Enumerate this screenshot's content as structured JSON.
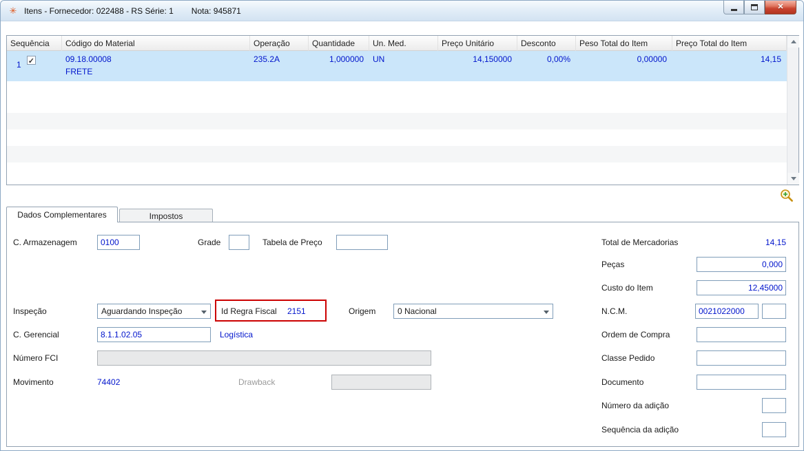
{
  "window": {
    "title_left": "Itens - Fornecedor: 022488 - RS Série: 1",
    "title_right": "Nota: 945871"
  },
  "grid": {
    "columns": [
      "Sequência",
      "Código do Material",
      "Operação",
      "Quantidade",
      "Un. Med.",
      "Preço Unitário",
      "Desconto",
      "Peso Total do Item",
      "Preço Total do Item"
    ],
    "rows": [
      {
        "sequencia": "1",
        "checked": true,
        "codigo": "09.18.00008",
        "descricao": "FRETE",
        "operacao": "235.2A",
        "quantidade": "1,000000",
        "un_med": "UN",
        "preco_unitario": "14,150000",
        "desconto": "0,00%",
        "peso_total_item": "0,00000",
        "preco_total_item": "14,15"
      }
    ]
  },
  "tabs": {
    "dados_complementares": "Dados Complementares",
    "impostos": "Impostos"
  },
  "form": {
    "c_armazenagem": {
      "label": "C. Armazenagem",
      "value": "0100"
    },
    "grade": {
      "label": "Grade",
      "value": ""
    },
    "tabela_preco": {
      "label": "Tabela de Preço",
      "value": ""
    },
    "total_mercadorias": {
      "label": "Total de Mercadorias",
      "value": "14,15"
    },
    "pecas": {
      "label": "Peças",
      "value": "0,000"
    },
    "custo_item": {
      "label": "Custo do Item",
      "value": "12,45000"
    },
    "inspecao": {
      "label": "Inspeção",
      "value": "Aguardando Inspeção"
    },
    "id_regra_fiscal": {
      "label": "Id Regra Fiscal",
      "value": "2151"
    },
    "origem": {
      "label": "Origem",
      "value": "0 Nacional"
    },
    "ncm": {
      "label": "N.C.M.",
      "value": "0021022000",
      "value2": ""
    },
    "c_gerencial": {
      "label": "C. Gerencial",
      "value": "8.1.1.02.05",
      "description": "Logística"
    },
    "ordem_compra": {
      "label": "Ordem de Compra",
      "value": ""
    },
    "numero_fci": {
      "label": "Número FCI",
      "value": ""
    },
    "classe_pedido": {
      "label": "Classe Pedido",
      "value": ""
    },
    "movimento": {
      "label": "Movimento",
      "value": "74402"
    },
    "drawback": {
      "label": "Drawback",
      "value": ""
    },
    "documento": {
      "label": "Documento",
      "value": ""
    },
    "numero_adicao": {
      "label": "Número da adição",
      "value": ""
    },
    "sequencia_adicao": {
      "label": "Sequência da adição",
      "value": ""
    }
  },
  "colors": {
    "value_text_blue": "#0014cc",
    "row_highlight": "#cbe6fa",
    "annotation_red": "#cc0000",
    "titlebar_gradient_top": "#f6fafd",
    "titlebar_gradient_bottom": "#d3e3f2"
  }
}
